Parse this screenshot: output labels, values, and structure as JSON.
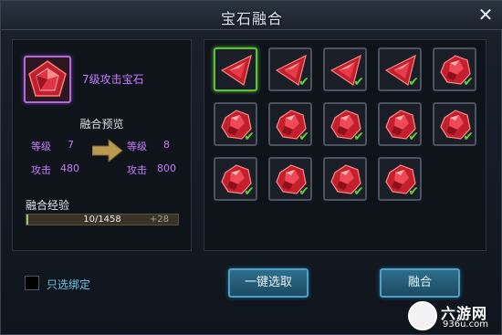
{
  "window": {
    "title": "宝石融合",
    "close_icon": "close-icon"
  },
  "gem": {
    "name": "7级攻击宝石",
    "icon": "red-gem-icon"
  },
  "preview": {
    "title": "融合预览",
    "before": {
      "level_label": "等级",
      "level": "7",
      "attack_label": "攻击",
      "attack": "480"
    },
    "after": {
      "level_label": "等级",
      "level": "8",
      "attack_label": "攻击",
      "attack": "800"
    }
  },
  "experience": {
    "label": "融合经验",
    "text": "10/1458",
    "plus": "+28",
    "progress": 0.007
  },
  "slots": [
    {
      "type": "triangle",
      "selected": true,
      "checked": false
    },
    {
      "type": "triangle",
      "selected": false,
      "checked": true
    },
    {
      "type": "triangle",
      "selected": false,
      "checked": true
    },
    {
      "type": "triangle",
      "selected": false,
      "checked": true
    },
    {
      "type": "rough",
      "selected": false,
      "checked": true
    },
    {
      "type": "rough",
      "selected": false,
      "checked": true
    },
    {
      "type": "rough",
      "selected": false,
      "checked": true
    },
    {
      "type": "rough",
      "selected": false,
      "checked": true
    },
    {
      "type": "rough",
      "selected": false,
      "checked": true
    },
    {
      "type": "rough",
      "selected": false,
      "checked": true
    },
    {
      "type": "rough",
      "selected": false,
      "checked": true
    },
    {
      "type": "rough",
      "selected": false,
      "checked": true
    },
    {
      "type": "rough",
      "selected": false,
      "checked": true
    },
    {
      "type": "rough",
      "selected": false,
      "checked": true
    }
  ],
  "filter": {
    "label": "只选绑定",
    "checked": false
  },
  "buttons": {
    "select_all": "一键选取",
    "fuse": "融合"
  },
  "watermark": {
    "big": "六游网",
    "small": "936u.com"
  },
  "colors": {
    "accent_purple": "#c77cff",
    "check_green": "#5fcf3a",
    "button_blue": "#2f6f8c"
  }
}
